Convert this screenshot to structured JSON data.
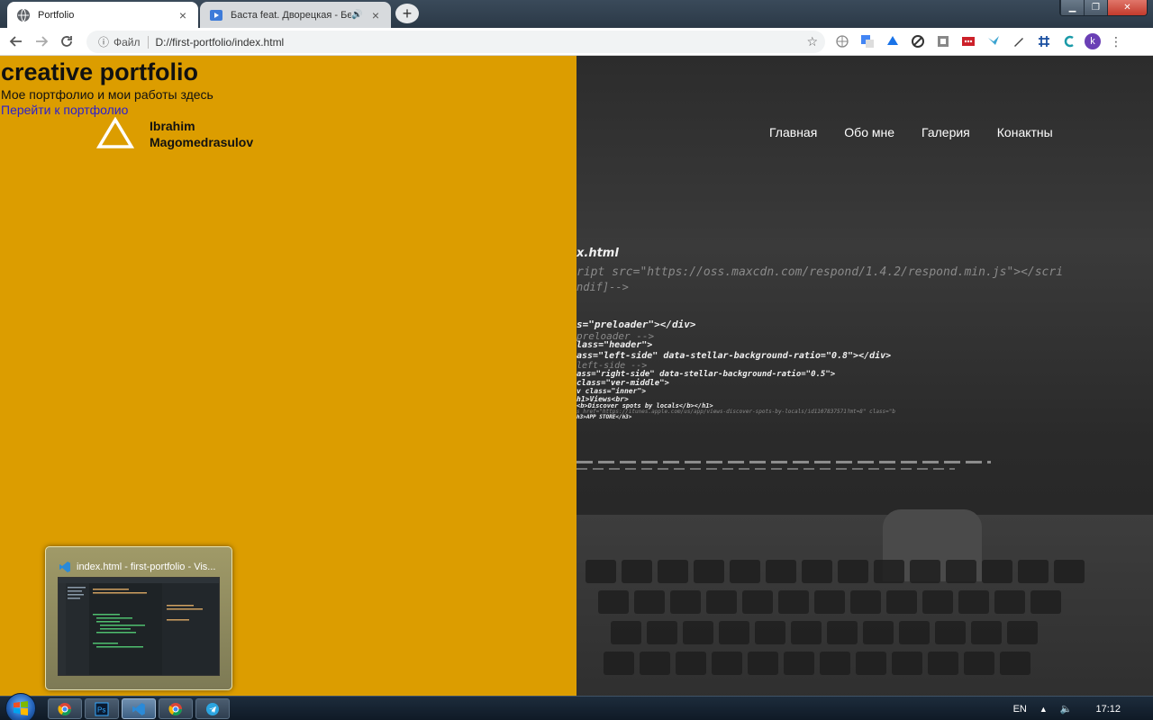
{
  "browser": {
    "tabs": [
      {
        "title": "Portfolio",
        "active": true
      },
      {
        "title": "Баста feat. Дворецкая - Без",
        "active": false
      }
    ],
    "new_tab_symbol": "+",
    "window_controls": {
      "minimize": "▁",
      "maximize": "❐",
      "close": "✕"
    },
    "address": {
      "scheme": "Файл",
      "url": "D://first-portfolio/index.html"
    },
    "profile_initial": "k"
  },
  "page": {
    "hero": {
      "title": "creative portfolio",
      "subtitle": "Мое портфолио и мои работы здесь",
      "link": "Перейти к портфолио"
    },
    "logo": {
      "name_line1": "Ibrahim",
      "name_line2": "Magomedrasulov"
    },
    "nav": [
      "Главная",
      "Обо мне",
      "Галерия",
      "Конактны"
    ],
    "code_lines": {
      "filename": "x.html",
      "l1": "ript src=\"https://oss.maxcdn.com/respond/1.4.2/respond.min.js\"></scri",
      "l2": "ndif]-->",
      "l3": "s=\"preloader\"></div>",
      "l4": "preloader -->",
      "l5": "lass=\"header\">",
      "l6": "ass=\"left-side\" data-stellar-background-ratio=\"0.8\"></div>",
      "l7": "left-side -->",
      "l8": "ass=\"right-side\" data-stellar-background-ratio=\"0.5\">",
      "l9": "class=\"ver-middle\">",
      "l10": "v class=\"inner\">",
      "l11": "h1>Views<br>",
      "l12": "<b>Discover spots by locals</b></h1>",
      "l13": "s href=\"https://itunes.apple.com/us/app/views-discover-spots-by-locals/id1107837571?mt=8\" class=\"b",
      "l14": "h3>APP STORE</h3>"
    }
  },
  "taskbar": {
    "preview_title": "index.html - first-portfolio - Vis...",
    "language": "EN",
    "clock": "17:12"
  },
  "colors": {
    "left_panel": "#dc9d00",
    "link": "#2a1fd1"
  }
}
